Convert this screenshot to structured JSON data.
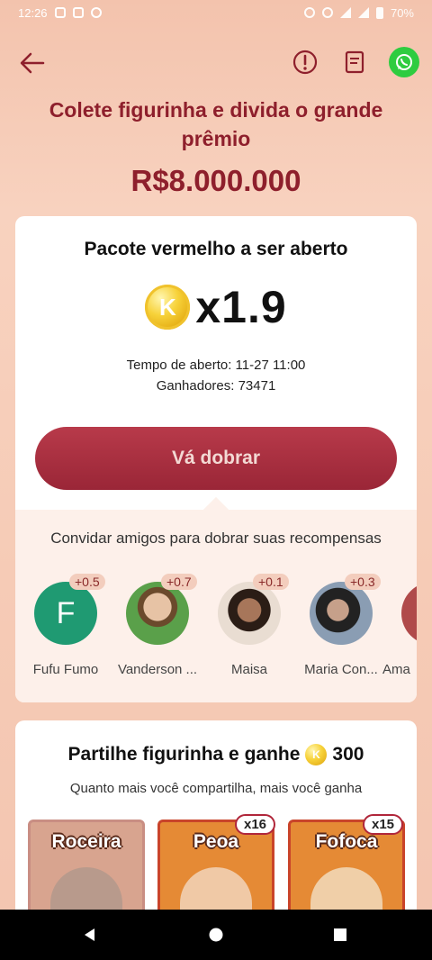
{
  "status_bar": {
    "time": "12:26",
    "battery": "70%"
  },
  "hero": {
    "title": "Colete figurinha e divida o grande prêmio",
    "prize": "R$8.000.000"
  },
  "packet": {
    "title": "Pacote vermelho a ser aberto",
    "coin_letter": "K",
    "multiplier": "x1.9",
    "open_time": "Tempo de aberto: 11-27 11:00",
    "winners": "Ganhadores: 73471",
    "button_label": "Vá dobrar"
  },
  "invite": {
    "title": "Convidar amigos para dobrar suas recompensas",
    "friends": [
      {
        "name": "Fufu Fumo",
        "bonus": "+0.5",
        "initial": "F"
      },
      {
        "name": "Vanderson ...",
        "bonus": "+0.7"
      },
      {
        "name": "Maisa",
        "bonus": "+0.1"
      },
      {
        "name": "Maria Con...",
        "bonus": "+0.3"
      },
      {
        "name": "Ama"
      }
    ]
  },
  "share": {
    "title": "Partilhe figurinha e ganhe",
    "coin_letter": "K",
    "amount": "300",
    "subtitle": "Quanto mais você compartilha, mais você ganha",
    "stickers": [
      {
        "label": "Roceira"
      },
      {
        "label": "Peoa",
        "count": "x16"
      },
      {
        "label": "Fofoca",
        "count": "x15"
      }
    ]
  },
  "colors": {
    "accent": "#8e1f2c",
    "button": "#a52d3f",
    "whatsapp": "#2ecc40"
  }
}
